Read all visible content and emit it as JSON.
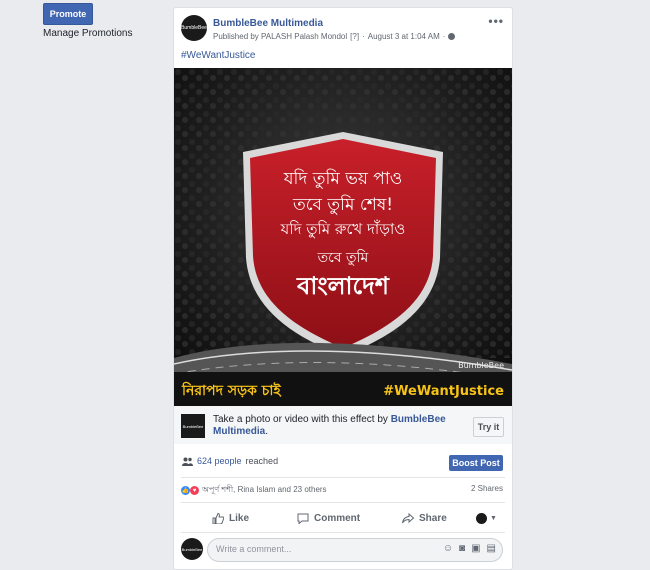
{
  "sidebar": {
    "promote_label": "Promote",
    "manage_label": "Manage Promotions"
  },
  "post": {
    "page_name": "BumbleBee Multimedia",
    "avatar_text": "BumbleBee",
    "published_by": "Published by PALASH Palash Mondol",
    "question_mark": "[?]",
    "date": "August 3 at 1:04 AM",
    "hashtag": "#WeWantJustice",
    "image": {
      "line1": "যদি তুমি ভয় পাও",
      "line2": "তবে তুমি শেষ!",
      "line3": "যদি তুমি রুখে দাঁড়াও",
      "line4": "তবে তুমি",
      "line5": "বাংলাদেশ",
      "bottom_left": "নিরাপদ সড়ক চাই",
      "bottom_right": "#WeWantJustice",
      "watermark": "BumbleBee"
    },
    "effect": {
      "thumb_text": "BumbleBee",
      "text_prefix": "Take a photo or video with this effect by ",
      "text_link": "BumbleBee Multimedia",
      "text_suffix": ".",
      "try_label": "Try it"
    },
    "reach": {
      "count": "624 people",
      "suffix": "reached",
      "boost_label": "Boost Post"
    },
    "reactions": {
      "names": "অপূর্ণ শশী, Rina Islam and 23 others",
      "shares": "2 Shares"
    },
    "actions": {
      "like": "Like",
      "comment": "Comment",
      "share": "Share"
    },
    "comment": {
      "placeholder": "Write a comment...",
      "avatar_text": "BumbleBee"
    }
  }
}
